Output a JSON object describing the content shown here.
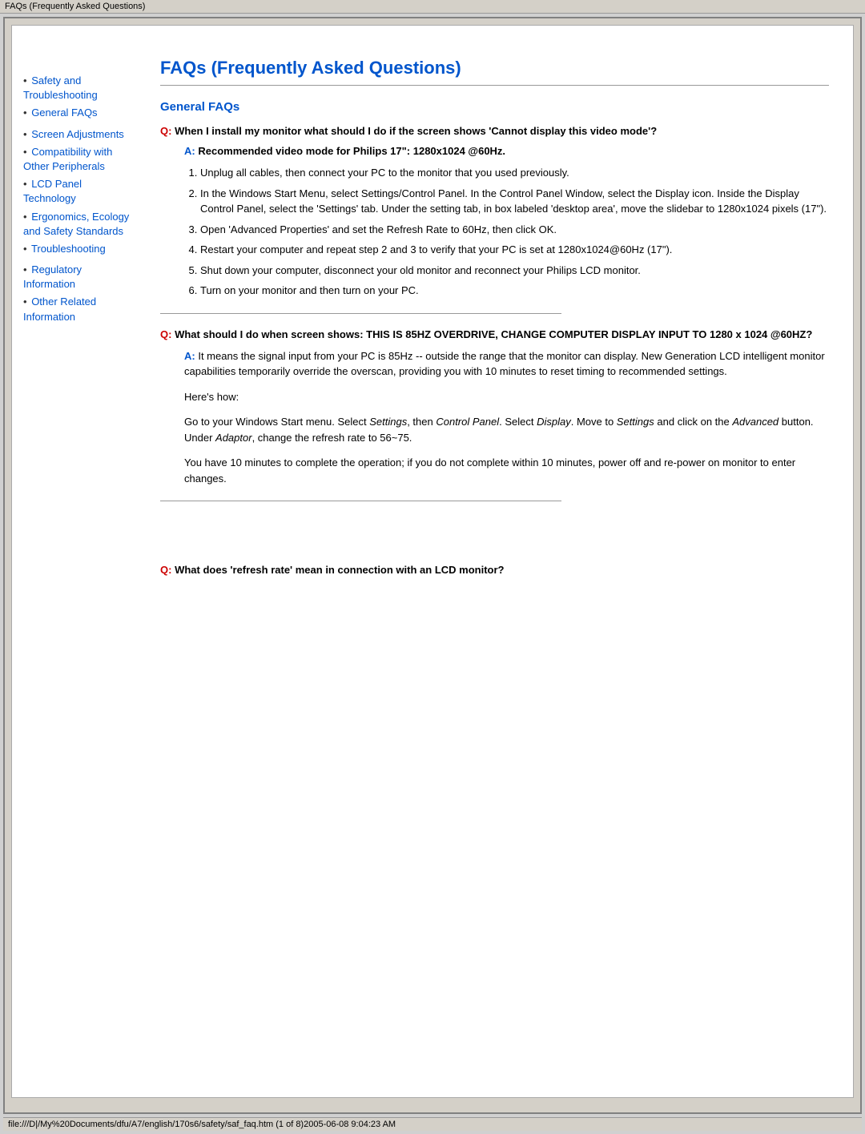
{
  "titlebar": {
    "text": "FAQs (Frequently Asked Questions)"
  },
  "statusbar": {
    "text": "file:///D|/My%20Documents/dfu/A7/english/170s6/safety/saf_faq.htm (1 of 8)2005-06-08 9:04:23 AM"
  },
  "sidebar": {
    "items": [
      {
        "id": "safety",
        "label": "Safety and Troubleshooting",
        "bullet": "•"
      },
      {
        "id": "general-faqs",
        "label": "General FAQs",
        "bullet": "•"
      },
      {
        "id": "screen",
        "label": "Screen Adjustments",
        "bullet": "•"
      },
      {
        "id": "compatibility",
        "label": "Compatibility with Other Peripherals",
        "bullet": "•"
      },
      {
        "id": "lcd",
        "label": "LCD Panel Technology",
        "bullet": "•"
      },
      {
        "id": "ergonomics",
        "label": "Ergonomics, Ecology and Safety Standards",
        "bullet": "•"
      },
      {
        "id": "troubleshooting",
        "label": "Troubleshooting",
        "bullet": "•"
      },
      {
        "id": "regulatory",
        "label": "Regulatory Information",
        "bullet": "•"
      },
      {
        "id": "other",
        "label": "Other Related Information",
        "bullet": "•"
      }
    ]
  },
  "main": {
    "page_title": "FAQs (Frequently Asked Questions)",
    "section_title": "General FAQs",
    "q1": {
      "q_label": "Q:",
      "question": "When I install my monitor what should I do if the screen shows 'Cannot display this video mode'?",
      "a_label": "A:",
      "answer_intro": "Recommended video mode for Philips 17\": 1280x1024 @60Hz.",
      "steps": [
        "Unplug all cables, then connect your PC to the monitor that you used previously.",
        "In the Windows Start Menu, select Settings/Control Panel. In the Control Panel Window, select the Display icon. Inside the Display Control Panel, select the 'Settings' tab. Under the setting tab, in box labeled 'desktop area', move the slidebar to 1280x1024 pixels (17\").",
        "Open 'Advanced Properties' and set the Refresh Rate to 60Hz, then click OK.",
        "Restart your computer and repeat step 2 and 3 to verify that your PC is set at 1280x1024@60Hz (17\").",
        "Shut down your computer, disconnect your old monitor and reconnect your Philips LCD monitor.",
        "Turn on your monitor and then turn on your PC."
      ]
    },
    "q2": {
      "q_label": "Q:",
      "question": "What should I do when screen shows: THIS IS 85HZ OVERDRIVE, CHANGE COMPUTER DISPLAY INPUT TO 1280 x 1024 @60HZ?",
      "a_label": "A:",
      "answer_text": "It means the signal input from your PC is 85Hz -- outside the range that the monitor can display. New Generation LCD intelligent monitor capabilities temporarily override the overscan, providing you with 10 minutes to reset timing to recommended settings.",
      "heres_how": "Here's how:",
      "go_to": "Go to your Windows Start menu. Select ",
      "settings_italic": "Settings",
      "then": ", then ",
      "control_panel_italic": "Control Panel",
      "select": ". Select ",
      "display_italic": "Display",
      "move_to": ". Move to ",
      "settings2_italic": "Settings",
      "click_on": " and click on the ",
      "advanced_italic": "Advanced",
      "button_text": " button. Under ",
      "adaptor_italic": "Adaptor",
      "change_text": ", change the refresh rate to 56~75.",
      "minutes_text": "You have 10 minutes to complete the operation; if you do not complete within 10 minutes, power off and re-power on monitor to enter changes."
    },
    "q3": {
      "q_label": "Q:",
      "question": "What does 'refresh rate' mean in connection with an LCD monitor?"
    }
  }
}
